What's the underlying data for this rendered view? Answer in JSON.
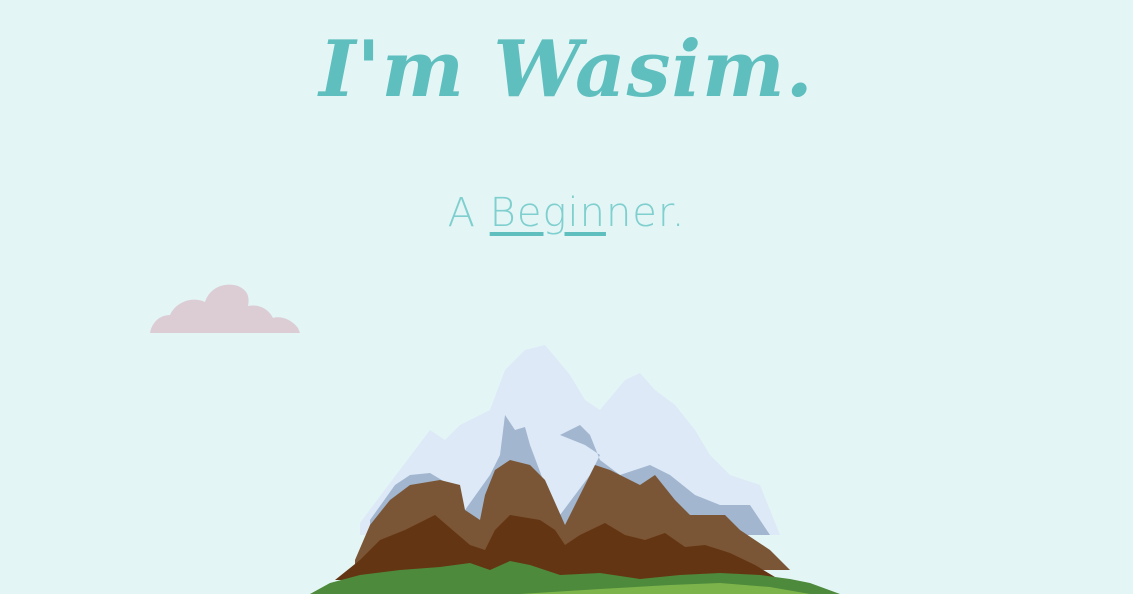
{
  "hero": {
    "headline": "I'm Wasim.",
    "subtitle_prefix": "A ",
    "subtitle_parts": [
      "Beg",
      "in",
      "ner",
      "."
    ]
  },
  "colors": {
    "background": "#e3f5f5",
    "accent": "#5fbfbf",
    "cloud": "#dccdd5",
    "snow": "#dde9f7",
    "shadow_snow": "#a2b6cf",
    "rock_light": "#7a5636",
    "rock_dark": "#643513",
    "grass_dark": "#4d8a3c",
    "grass_light": "#7cb34b"
  }
}
